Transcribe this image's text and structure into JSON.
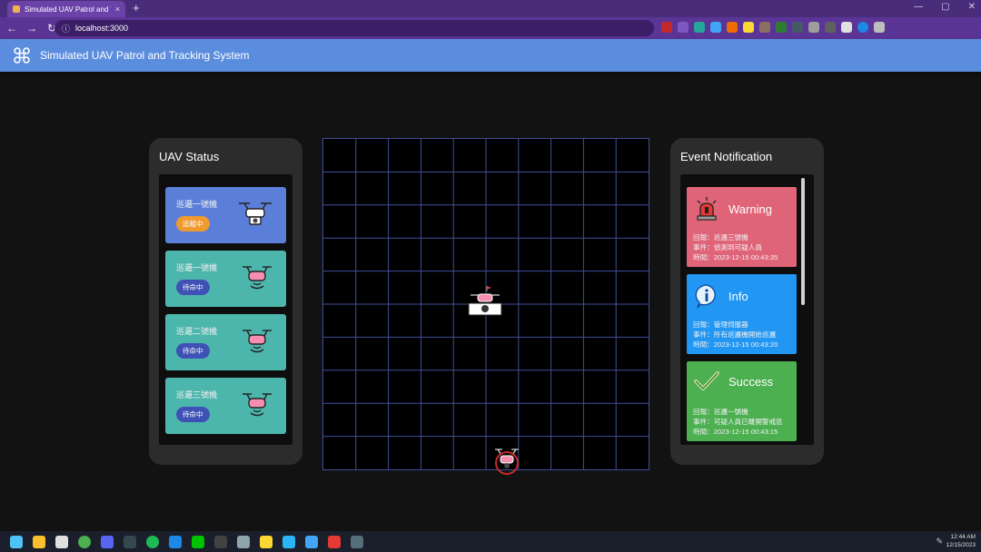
{
  "browser": {
    "tab_title": "Simulated UAV Patrol and Tracking",
    "tab_close": "×",
    "new_tab": "+",
    "url": "localhost:3000",
    "window_controls": [
      "—",
      "▢",
      "✕"
    ]
  },
  "app": {
    "title": "Simulated UAV Patrol and Tracking System"
  },
  "uav_panel": {
    "title": "UAV Status",
    "cards": [
      {
        "name": "巡邏一號機",
        "status": "追蹤中",
        "card_color": "#5b7fd8",
        "pill_color": "#ef9a2f"
      },
      {
        "name": "巡邏一號機",
        "status": "待命中",
        "card_color": "#4db6ac",
        "pill_color": "#3f51b5"
      },
      {
        "name": "巡邏二號機",
        "status": "待命中",
        "card_color": "#4db6ac",
        "pill_color": "#3f51b5"
      },
      {
        "name": "巡邏三號機",
        "status": "待命中",
        "card_color": "#4db6ac",
        "pill_color": "#3f51b5"
      }
    ]
  },
  "event_panel": {
    "title": "Event Notification",
    "events": [
      {
        "type": "Warning",
        "icon": "alarm-light-icon",
        "color": "#e06478",
        "lines": [
          "回報：巡邏三號機",
          "事件：偵測到可疑人員",
          "時間：2023-12-15 00:43:35"
        ]
      },
      {
        "type": "Info",
        "icon": "info-icon",
        "color": "#2196f3",
        "lines": [
          "回報：管理伺服器",
          "事件：所有巡邏機開始巡邏",
          "時間：2023-12-15 00:43:20"
        ]
      },
      {
        "type": "Success",
        "icon": "checkmark-icon",
        "color": "#4caf50",
        "lines": [
          "回報：巡邏一號機",
          "事件：可疑人員已離開警戒區",
          "時間：2023-12-15 00:43:15"
        ]
      }
    ]
  },
  "map": {
    "grid_color": "#3f4f9a"
  },
  "tray": {
    "time": "12:44 AM",
    "date": "12/15/2023"
  }
}
